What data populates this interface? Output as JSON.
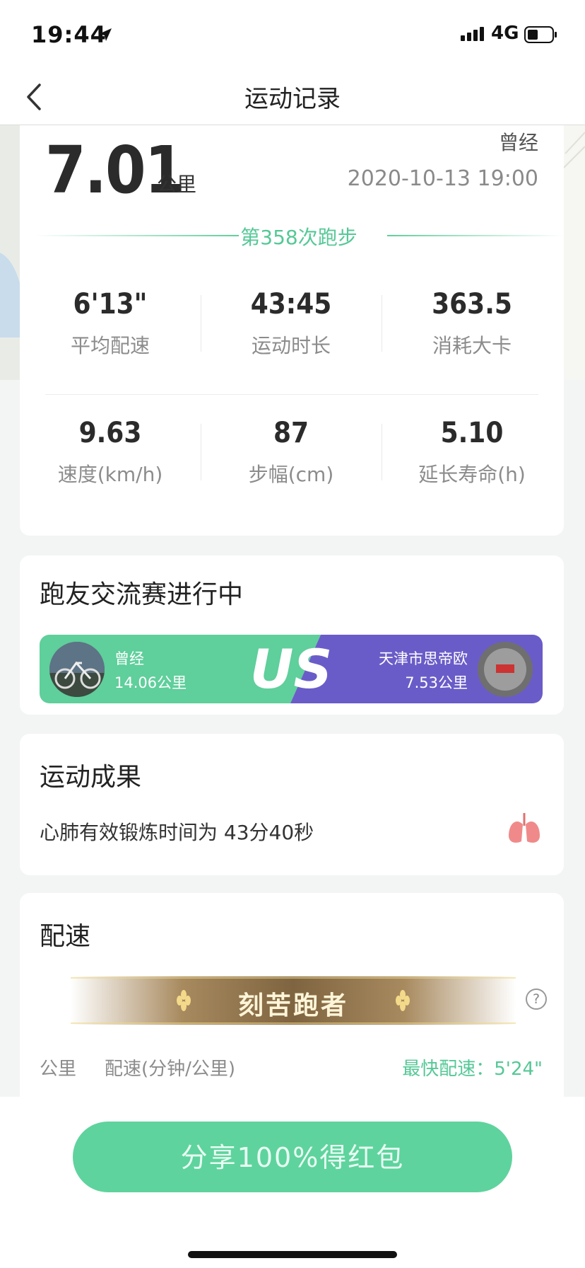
{
  "status_bar": {
    "time": "19:44",
    "network": "4G"
  },
  "nav": {
    "title": "运动记录"
  },
  "summary": {
    "distance": "7.01",
    "distance_unit": "公里",
    "user_name": "曾经",
    "datetime": "2020-10-13 19:00",
    "run_count": "第358次跑步",
    "stats": [
      {
        "value": "6'13\"",
        "label": "平均配速"
      },
      {
        "value": "43:45",
        "label": "运动时长"
      },
      {
        "value": "363.5",
        "label": "消耗大卡"
      },
      {
        "value": "9.63",
        "label": "速度(km/h)"
      },
      {
        "value": "87",
        "label": "步幅(cm)"
      },
      {
        "value": "5.10",
        "label": "延长寿命(h)"
      }
    ]
  },
  "competition": {
    "title": "跑友交流赛进行中",
    "vs_label": "US",
    "left": {
      "name": "曾经",
      "distance": "14.06公里",
      "color": "#5fcf9b"
    },
    "right": {
      "name": "天津市思帝欧",
      "distance": "7.53公里",
      "color": "#6a5cc8"
    }
  },
  "result": {
    "title": "运动成果",
    "text": "心肺有效锻炼时间为 43分40秒",
    "icon": "lungs-icon"
  },
  "pace": {
    "title": "配速",
    "badge": "刻苦跑者",
    "help": "?",
    "col_km": "公里",
    "col_pace": "配速(分钟/公里)",
    "fastest": "最快配速：5'24\""
  },
  "share_button": "分享100%得红包"
}
